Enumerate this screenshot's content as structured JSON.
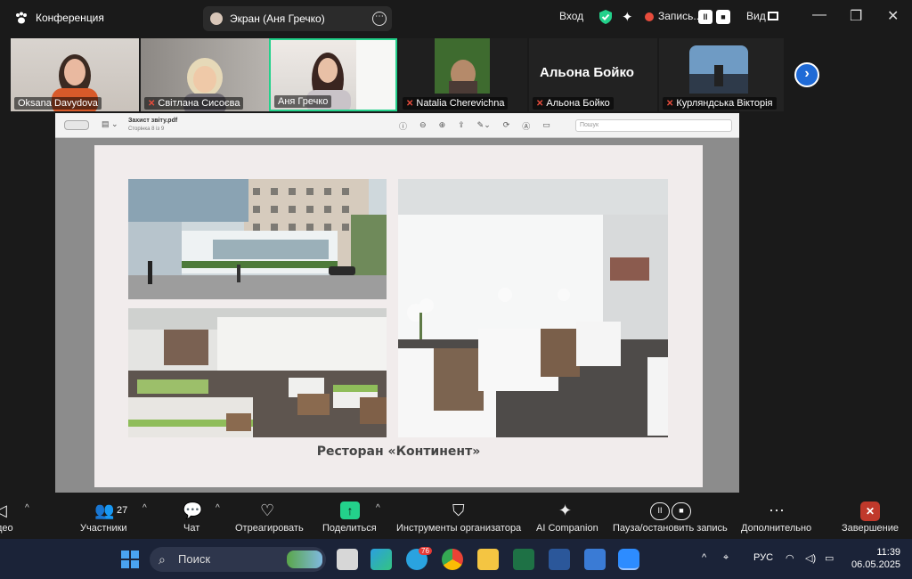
{
  "topbar": {
    "app_title": "Конференция",
    "share_label": "Экран (Аня Гречко)",
    "signin": "Вход",
    "recording": "Запись...",
    "view": "Вид"
  },
  "participants": [
    {
      "name": "Oksana Davydova",
      "muted": false
    },
    {
      "name": "Світлана Сисоєва",
      "muted": true
    },
    {
      "name": "Аня Гречко",
      "muted": false
    },
    {
      "name": "Natalia Cherevichna",
      "muted": true
    },
    {
      "name": "Альона Бойко",
      "muted": true
    },
    {
      "name": "Курляндська Вікторія",
      "muted": true
    }
  ],
  "big_name": "Альона Бойко",
  "pdf": {
    "title": "Захист звіту.pdf",
    "subtitle": "Сторінка 8 із 9",
    "search_placeholder": "Пошук",
    "caption": "Ресторан «Континент»"
  },
  "toolbar": {
    "video": "део",
    "participants": "Участники",
    "participants_count": "27",
    "chat": "Чат",
    "react": "Отреагировать",
    "share": "Поделиться",
    "host_tools": "Инструменты организатора",
    "ai": "AI Companion",
    "pause_rec": "Пауза/остановить запись",
    "more": "Дополнительно",
    "end": "Завершение"
  },
  "taskbar": {
    "search": "Поиск",
    "lang": "РУС",
    "time": "11:39",
    "date": "06.05.2025",
    "badge": "76"
  },
  "colors": {
    "accent_green": "#23d18b",
    "zoom_blue": "#1f6ad6",
    "mute_red": "#e74c3c"
  }
}
